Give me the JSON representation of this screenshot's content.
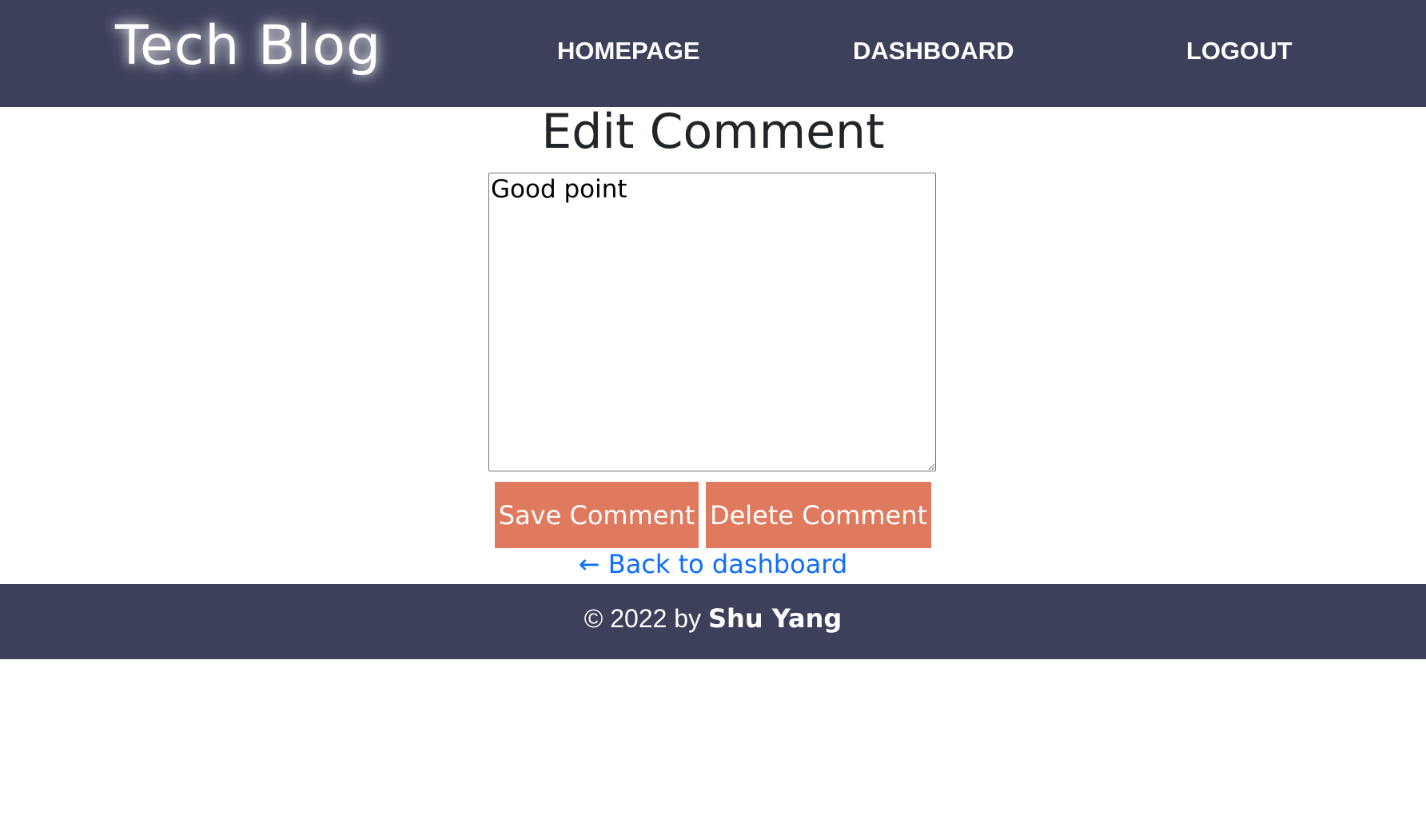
{
  "header": {
    "brand": "Tech Blog",
    "nav": {
      "homepage": "HOMEPAGE",
      "dashboard": "DASHBOARD",
      "logout": "LOGOUT"
    }
  },
  "main": {
    "title": "Edit Comment",
    "comment_value": "Good point",
    "save_label": "Save Comment",
    "delete_label": "Delete Comment",
    "back_arrow": "←",
    "back_label": "Back to dashboard"
  },
  "footer": {
    "prefix": "© 2022 by",
    "author": "Shu Yang"
  },
  "colors": {
    "header_bg": "#3d405b",
    "button_bg": "#e07a5f",
    "link": "#0d6efd"
  }
}
